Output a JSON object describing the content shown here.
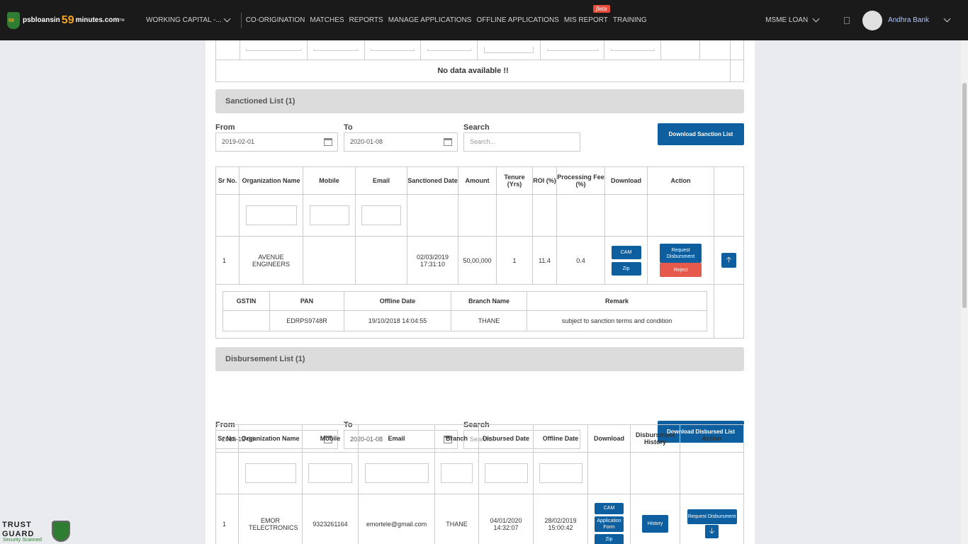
{
  "nav": {
    "logo_left": "psbloansin",
    "logo_59": "59",
    "logo_right": "minutes.com",
    "logo_tm": "TM",
    "logo_badge": "59",
    "working_capital": "WORKING CAPITAL -...",
    "items": [
      "CO-ORIGINATION",
      "MATCHES",
      "REPORTS",
      "MANAGE APPLICATIONS",
      "OFFLINE APPLICATIONS",
      "MIS REPORT",
      "TRAINING"
    ],
    "beta": "βeta",
    "msme": "MSME LOAN",
    "bank": "Andhra Bank"
  },
  "top_table": {
    "no_data": "No data available !!"
  },
  "sanctioned": {
    "header": "Sanctioned List (1)",
    "from_label": "From",
    "from_value": "2019-02-01",
    "to_label": "To",
    "to_value": "2020-01-08",
    "search_label": "Search",
    "search_placeholder": "Search...",
    "download_btn": "Download Sanction List",
    "columns": [
      "Sr No.",
      "Organization Name",
      "Mobile",
      "Email",
      "Sanctioned Date",
      "Amount",
      "Tenure (Yrs)",
      "ROI (%)",
      "Processing Fee (%)",
      "Download",
      "Action"
    ],
    "row": {
      "sr": "1",
      "org": "AVENUE ENGINEERS",
      "mobile": "",
      "email": "",
      "date": "02/03/2019 17:31:10",
      "amount": "50,00,000",
      "tenure": "1",
      "roi": "11.4",
      "fee": "0.4",
      "cam": "CAM",
      "zip": "Zip",
      "request": "Request Disbursment",
      "reject": "Reject"
    },
    "sub_columns": [
      "GSTIN",
      "PAN",
      "Offline Date",
      "Branch Name",
      "Remark"
    ],
    "sub_row": {
      "gstin": "",
      "pan": "EDRPS9748R",
      "offline_date": "19/10/2018 14:04:55",
      "branch": "THANE",
      "remark": "subject to sanction terms and condition"
    }
  },
  "disbursement": {
    "header": "Disbursement List (1)",
    "from_label": "From",
    "from_value": "2019-12-08",
    "to_label": "To",
    "to_value": "2020-01-08",
    "search_label": "Search",
    "search_placeholder": "Search...",
    "download_btn": "Download Disbursed List",
    "columns": [
      "Sr No.",
      "Organization Name",
      "Mobile",
      "Email",
      "Branch",
      "Disbursed Date",
      "Offline Date",
      "Download",
      "Disbursment History",
      "Action"
    ],
    "row": {
      "sr": "1",
      "org": "EMOR TELECTRONICS",
      "mobile": "9323261164",
      "email": "emortele@gmail.com",
      "branch": "THANE",
      "disbursed_date": "04/01/2020 14:32:07",
      "offline_date": "28/02/2019 15:00:42",
      "cam": "CAM",
      "app_form": "Application Form",
      "zip": "Zip",
      "history": "History",
      "request": "Request Disbursment"
    }
  },
  "trustguard": {
    "line1": "TRUST",
    "line2": "GUARD",
    "sub": "Security Scanned"
  },
  "colors": {
    "primary": "#0d5fa0",
    "danger": "#e55a4c",
    "topbar": "#1a1a1a",
    "accent": "#f6a623"
  }
}
